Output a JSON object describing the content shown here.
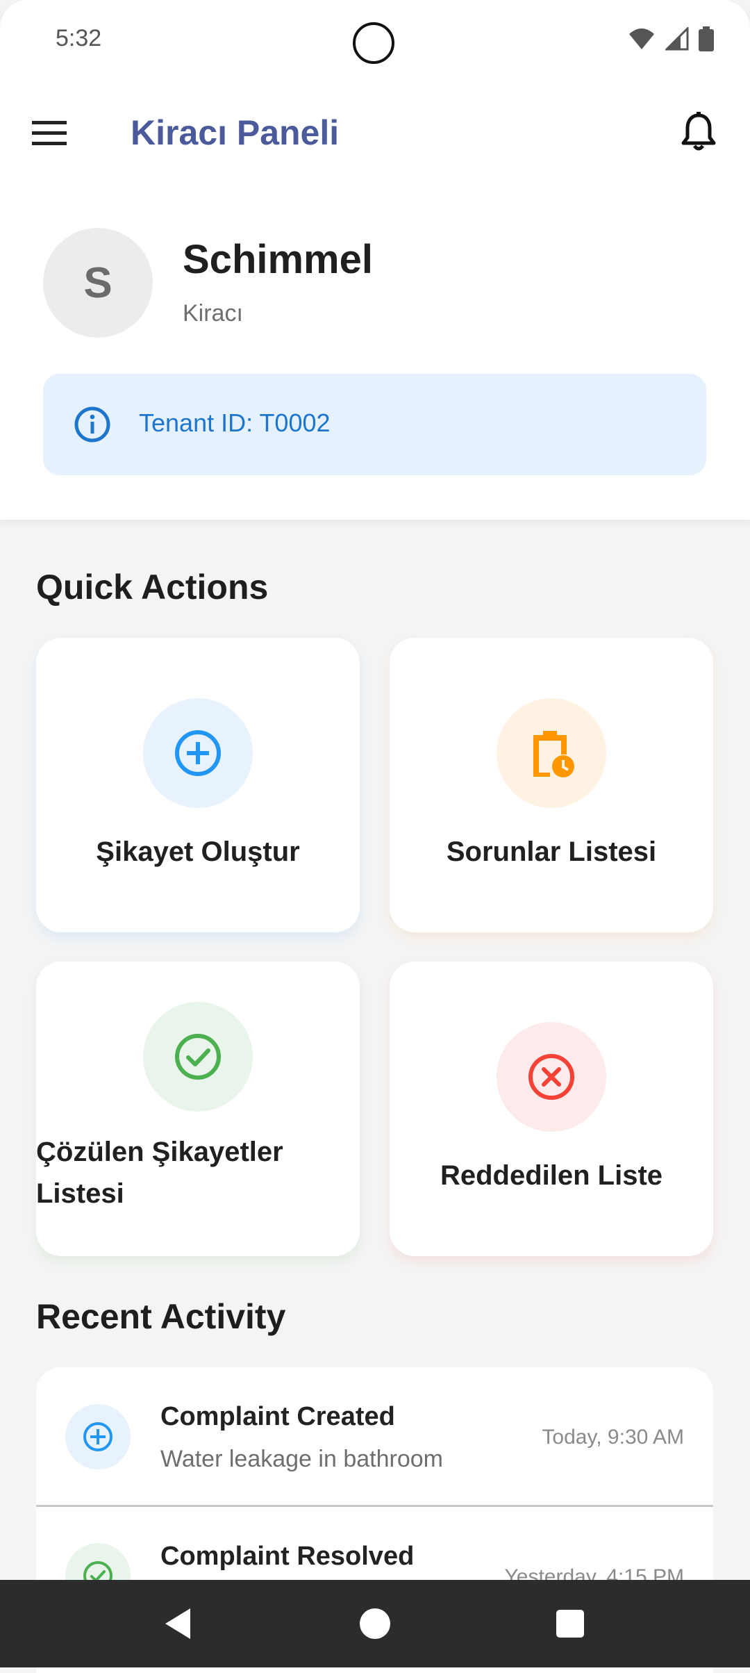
{
  "status_bar": {
    "time": "5:32"
  },
  "app_bar": {
    "title": "Kiracı Paneli"
  },
  "profile": {
    "initial": "S",
    "name": "Schimmel",
    "role": "Kiracı",
    "tenant_id_text": "Tenant ID: T0002"
  },
  "quick_actions": {
    "title": "Quick Actions",
    "items": [
      {
        "label": "Şikayet Oluştur",
        "icon": "add-circle-icon",
        "color": "#2196f3",
        "bg": "#e8f2fc"
      },
      {
        "label": "Sorunlar Listesi",
        "icon": "clipboard-clock-icon",
        "color": "#ff9800",
        "bg": "#fff2e3"
      },
      {
        "label": "Çözülen Şikayetler Listesi",
        "icon": "check-circle-icon",
        "color": "#4caf50",
        "bg": "#e9f5ea"
      },
      {
        "label": "Reddedilen Liste",
        "icon": "cancel-circle-icon",
        "color": "#f44336",
        "bg": "#fdeaea"
      }
    ]
  },
  "recent_activity": {
    "title": "Recent Activity",
    "items": [
      {
        "title": "Complaint Created",
        "subtitle": "Water leakage in bathroom",
        "time": "Today, 9:30 AM",
        "icon": "add-circle-icon"
      },
      {
        "title": "Complaint Resolved",
        "subtitle": "",
        "time": "Yesterday, 4:15 PM",
        "icon": "check-circle-icon"
      }
    ]
  }
}
